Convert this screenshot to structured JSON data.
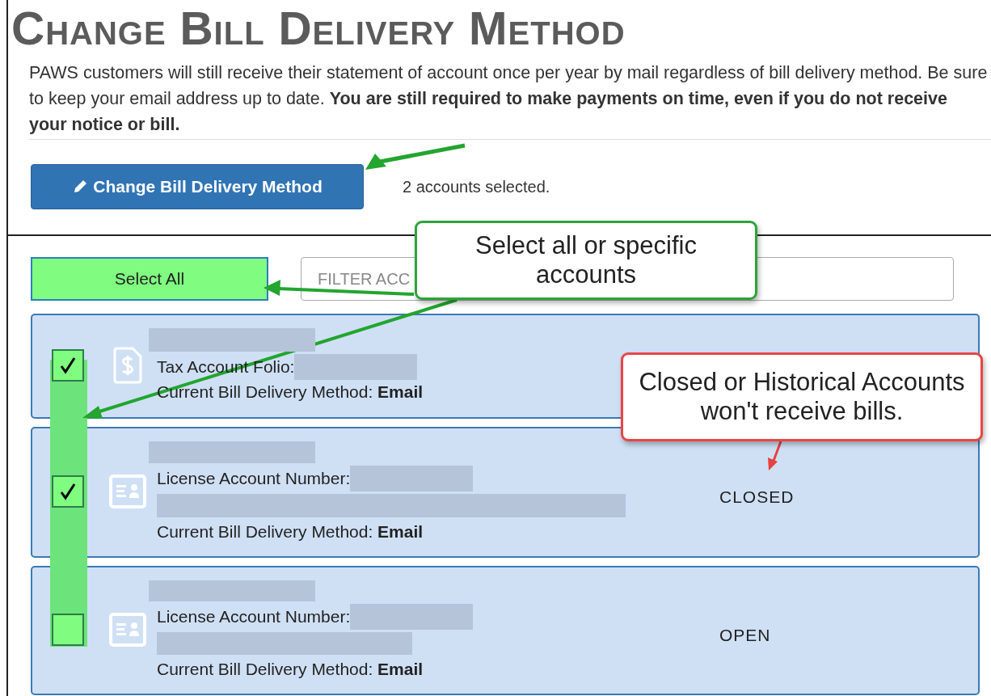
{
  "title": "Change Bill Delivery Method",
  "notice": "PAWS customers will still receive their statement of account once per year by mail regardless of bill delivery method. Be sure to keep your email address up to date. **You are still required to make payments on time, even if you do not receive your notice or bill.**",
  "change_button": "Change Bill Delivery Method",
  "selection_count": "2 accounts selected.",
  "select_all_button": "Select All",
  "filter": {
    "placeholder": "FILTER ACC"
  },
  "accounts": [
    {
      "kind": "tax",
      "checked": true,
      "number_label": "Tax Account Folio:",
      "extra_line": false,
      "method_label": "Current Bill Delivery Method:",
      "method": "Email"
    },
    {
      "kind": "license",
      "checked": true,
      "number_label": "License Account Number:",
      "extra_line": true,
      "status": "CLOSED",
      "method_label": "Current Bill Delivery Method:",
      "method": "Email"
    },
    {
      "kind": "license",
      "checked": false,
      "number_label": "License Account Number:",
      "extra_line": true,
      "status": "OPEN",
      "method_label": "Current Bill Delivery Method:",
      "method": "Email"
    }
  ],
  "callouts": [
    {
      "kind": "green",
      "text": "Select all or specific accounts"
    },
    {
      "kind": "red",
      "text": "Closed or Historical Accounts won't receive bills."
    }
  ]
}
